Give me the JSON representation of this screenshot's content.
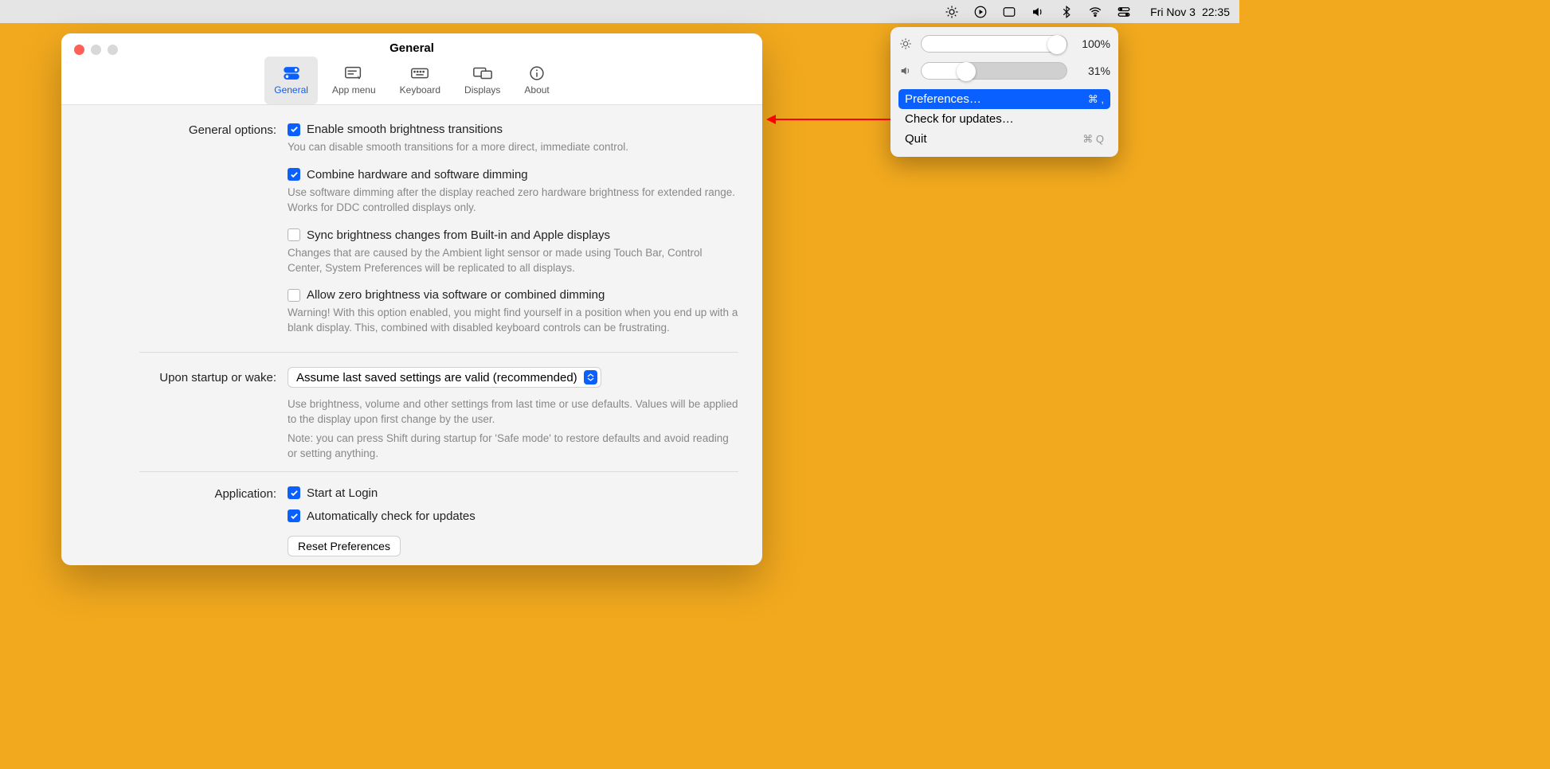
{
  "menubar": {
    "date": "Fri Nov 3",
    "time": "22:35"
  },
  "window": {
    "title": "General",
    "tabs": {
      "general": "General",
      "appmenu": "App menu",
      "keyboard": "Keyboard",
      "displays": "Displays",
      "about": "About"
    }
  },
  "sections": {
    "general_options_label": "General options:",
    "startup_label": "Upon startup or wake:",
    "application_label": "Application:"
  },
  "options": {
    "smooth": {
      "label": "Enable smooth brightness transitions",
      "hint": "You can disable smooth transitions for a more direct, immediate control."
    },
    "combine": {
      "label": "Combine hardware and software dimming",
      "hint": "Use software dimming after the display reached zero hardware brightness for extended range. Works for DDC controlled displays only."
    },
    "sync": {
      "label": "Sync brightness changes from Built-in and Apple displays",
      "hint": "Changes that are caused by the Ambient light sensor or made using Touch Bar, Control Center, System Preferences will be replicated to all displays."
    },
    "zero": {
      "label": "Allow zero brightness via software or combined dimming",
      "hint": "Warning! With this option enabled, you might find yourself in a position when you end up with a blank display. This, combined with disabled keyboard controls can be frustrating."
    },
    "startup_select": "Assume last saved settings are valid (recommended)",
    "startup_hint1": "Use brightness, volume and other settings from last time or use defaults. Values will be applied to the display upon first change by the user.",
    "startup_hint2": "Note: you can press Shift during startup for 'Safe mode' to restore defaults and avoid reading or setting anything.",
    "start_login": "Start at Login",
    "auto_update": "Automatically check for updates",
    "reset_btn": "Reset Preferences"
  },
  "popover": {
    "brightness_value": "100%",
    "volume_value": "31%",
    "menu": {
      "preferences": "Preferences…",
      "preferences_shortcut": "⌘ ,",
      "check_updates": "Check for updates…",
      "quit": "Quit",
      "quit_shortcut": "⌘ Q"
    }
  }
}
